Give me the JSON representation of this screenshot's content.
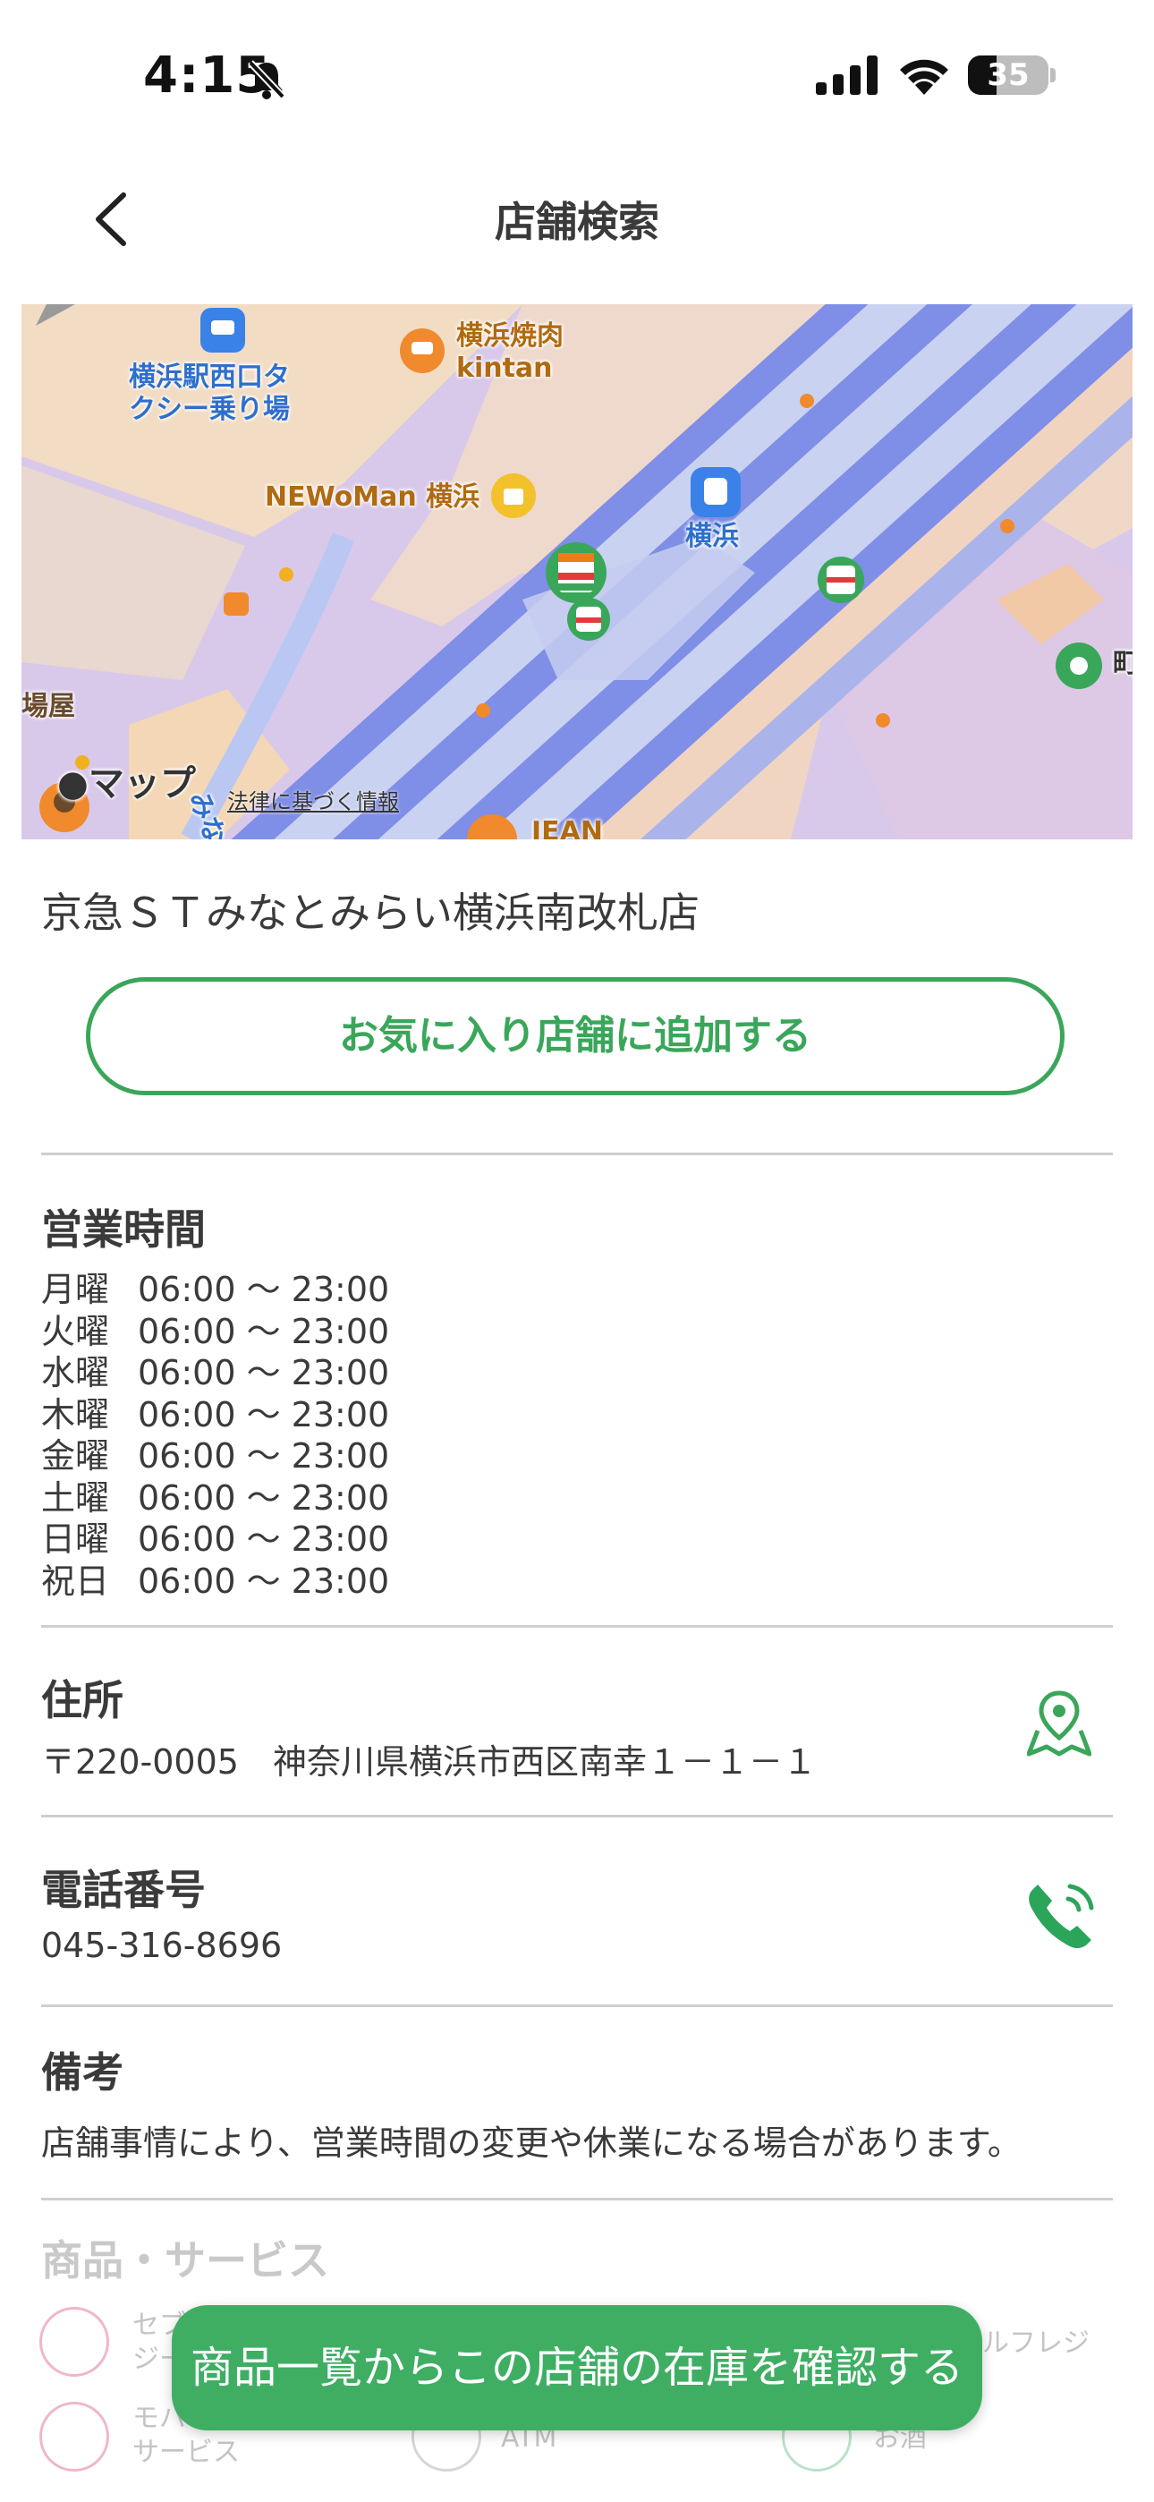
{
  "status_bar": {
    "time": "4:15",
    "battery": "35"
  },
  "nav": {
    "title": "店舗検索"
  },
  "map": {
    "labels": {
      "taxi": "横浜駅西口タ\nクシー乗り場",
      "kintan": "横浜焼肉\nkintan",
      "newoman": "NEWoMan 横浜",
      "yokohama": "横浜",
      "minatomirai": "みなとみらい",
      "left_cut": "場屋",
      "bottom_cut": "JEAN",
      "right_cut": "町",
      "maps_brand": "マップ",
      "legal": "法律に基づく情報"
    }
  },
  "store": {
    "name": "京急ＳＴみなとみらい横浜南改札店",
    "favorite_button": "お気に入り店舗に追加する"
  },
  "hours": {
    "title": "営業時間",
    "rows": [
      {
        "day": "月曜",
        "time": "06:00 〜 23:00"
      },
      {
        "day": "火曜",
        "time": "06:00 〜 23:00"
      },
      {
        "day": "水曜",
        "time": "06:00 〜 23:00"
      },
      {
        "day": "木曜",
        "time": "06:00 〜 23:00"
      },
      {
        "day": "金曜",
        "time": "06:00 〜 23:00"
      },
      {
        "day": "土曜",
        "time": "06:00 〜 23:00"
      },
      {
        "day": "日曜",
        "time": "06:00 〜 23:00"
      },
      {
        "day": "祝日",
        "time": "06:00 〜 23:00"
      }
    ]
  },
  "address": {
    "title": "住所",
    "value": "〒220-0005　神奈川県横浜市西区南幸１－１－１"
  },
  "phone": {
    "title": "電話番号",
    "value": "045-316-8696"
  },
  "notes": {
    "title": "備考",
    "value": "店舗事情により、営業時間の変更や休業になる場合があります。"
  },
  "products": {
    "title": "商品・サービス",
    "items": [
      {
        "label": "セブ\nジー",
        "icon": "cup-icon",
        "color": "#e46c8c"
      },
      {
        "label": "ルフレジ",
        "icon": "register-icon",
        "color": "#c4c4c4"
      },
      {
        "label": "モバイ\nサービス",
        "icon": "battery-charge-icon",
        "color": "#e46c8c"
      },
      {
        "label": "ATM",
        "icon": "atm-icon",
        "color": "#c4c4c4"
      },
      {
        "label": "お酒",
        "icon": "liquor-icon",
        "color": "#3fae63"
      }
    ]
  },
  "cta": {
    "label": "商品一覧からこの店舗の在庫を確認する"
  },
  "colors": {
    "accent": "#3aa65a",
    "cta_bg": "#3fae63",
    "divider": "#cfcfcf"
  }
}
